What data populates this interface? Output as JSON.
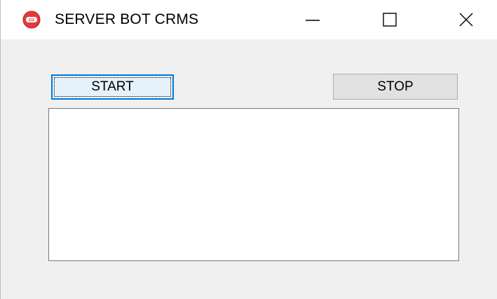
{
  "window": {
    "title": "SERVER BOT CRMS",
    "icon": "red-round-app-icon",
    "controls": {
      "minimize": "minimize-icon",
      "maximize": "maximize-icon",
      "close": "close-icon"
    }
  },
  "buttons": {
    "start_label": "START",
    "stop_label": "STOP"
  },
  "log": {
    "value": ""
  },
  "colors": {
    "focus_border": "#0078d7",
    "background": "#f0f0f0",
    "icon_red": "#e23b3b"
  }
}
